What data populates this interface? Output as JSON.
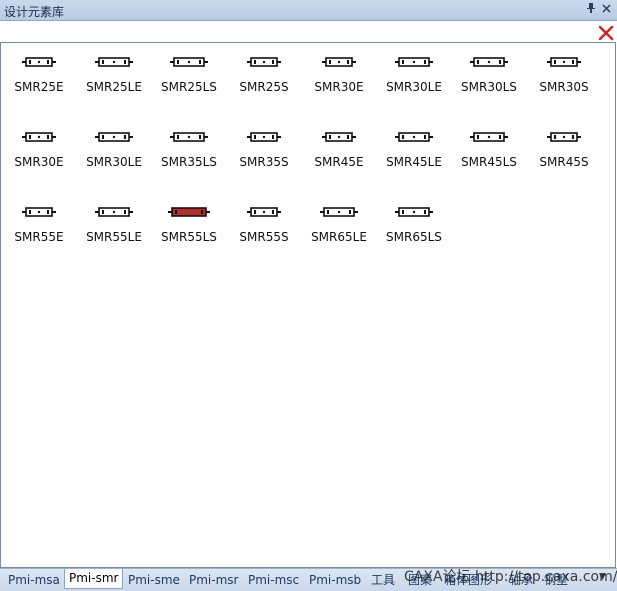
{
  "window": {
    "title": "设计元素库",
    "pin_icon": "pin-icon",
    "close_icon": "close-icon"
  },
  "panel": {
    "close_icon": "red-close-icon",
    "items": [
      {
        "label": "SMR25E",
        "color": "#222222"
      },
      {
        "label": "SMR25LE",
        "color": "#222222"
      },
      {
        "label": "SMR25LS",
        "color": "#222222"
      },
      {
        "label": "SMR25S",
        "color": "#222222"
      },
      {
        "label": "SMR30E",
        "color": "#222222"
      },
      {
        "label": "SMR30LE",
        "color": "#222222"
      },
      {
        "label": "SMR30LS",
        "color": "#222222"
      },
      {
        "label": "SMR30S",
        "color": "#222222"
      },
      {
        "label": "SMR30E",
        "color": "#222222"
      },
      {
        "label": "SMR30LE",
        "color": "#222222"
      },
      {
        "label": "SMR35LS",
        "color": "#222222"
      },
      {
        "label": "SMR35S",
        "color": "#222222"
      },
      {
        "label": "SMR45E",
        "color": "#222222"
      },
      {
        "label": "SMR45LE",
        "color": "#222222"
      },
      {
        "label": "SMR45LS",
        "color": "#222222"
      },
      {
        "label": "SMR45S",
        "color": "#222222"
      },
      {
        "label": "SMR55E",
        "color": "#222222"
      },
      {
        "label": "SMR55LE",
        "color": "#222222"
      },
      {
        "label": "SMR55LS",
        "color": "#b03030"
      },
      {
        "label": "SMR55S",
        "color": "#222222"
      },
      {
        "label": "SMR65LE",
        "color": "#222222"
      },
      {
        "label": "SMR65LS",
        "color": "#222222"
      }
    ]
  },
  "tabs": [
    {
      "label": "Pmi-msa",
      "active": false
    },
    {
      "label": "Pmi-smr",
      "active": true
    },
    {
      "label": "Pmi-sme",
      "active": false
    },
    {
      "label": "Pmi-msr",
      "active": false
    },
    {
      "label": "Pmi-msc",
      "active": false
    },
    {
      "label": "Pmi-msb",
      "active": false
    },
    {
      "label": "工具",
      "active": false
    },
    {
      "label": "图案",
      "active": false
    },
    {
      "label": "箱体图形",
      "active": false
    },
    {
      "label": "轴承",
      "active": false
    },
    {
      "label": "钢型",
      "active": false
    }
  ],
  "watermark": "CAXA论坛 http://top.caxa.com/",
  "tab_scroll_icon": "chevron-down-icon"
}
